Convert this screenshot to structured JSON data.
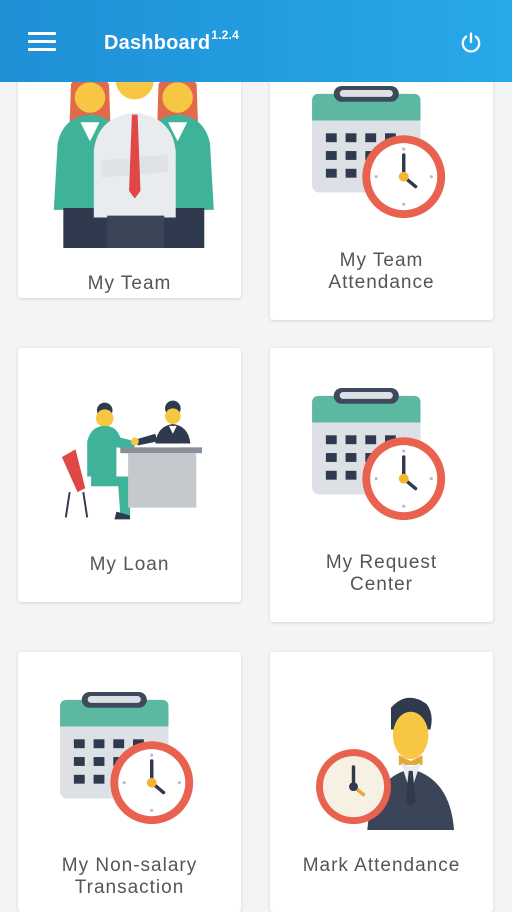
{
  "header": {
    "title": "Dashboard",
    "version": "1.2.4",
    "menu_icon": "hamburger-menu-icon",
    "power_icon": "power-icon",
    "background": "#1f8fd6"
  },
  "cards": [
    {
      "label": "My Team",
      "icon": "team-icon"
    },
    {
      "label": "My Team Attendance",
      "line1": "My Team",
      "line2": "Attendance",
      "icon": "calendar-clock-icon"
    },
    {
      "label": "My Loan",
      "icon": "loan-meeting-icon"
    },
    {
      "label": "My Request Center",
      "line1": "My Request",
      "line2": "Center",
      "icon": "calendar-clock-icon"
    },
    {
      "label": "My Non-salary Transaction",
      "line1": "My Non-salary",
      "line2": "Transaction",
      "icon": "calendar-clock-icon"
    },
    {
      "label": "Mark Attendance",
      "icon": "attendance-clock-person-icon"
    }
  ]
}
